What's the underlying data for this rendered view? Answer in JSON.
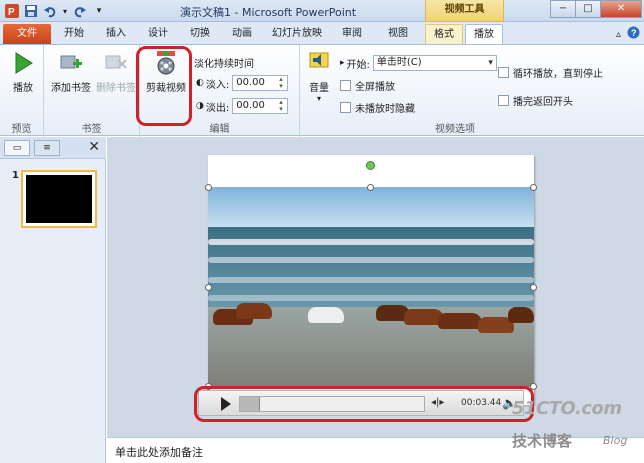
{
  "window": {
    "title": "演示文稿1 - Microsoft PowerPoint",
    "context_tab_group": "视频工具",
    "minimize": "−",
    "maximize": "□",
    "close": "✕"
  },
  "tabs": {
    "file": "文件",
    "items": [
      "开始",
      "插入",
      "设计",
      "切换",
      "动画",
      "幻灯片放映",
      "审阅",
      "视图",
      "格式",
      "播放"
    ],
    "active": "播放"
  },
  "ribbon": {
    "preview": {
      "button": "播放",
      "group": "预览"
    },
    "bookmarks": {
      "add": "添加书签",
      "remove": "删除书签",
      "group": "书签"
    },
    "editing": {
      "trim": "剪裁视频",
      "fade_title": "淡化持续时间",
      "fade_in_label": "淡入:",
      "fade_in_value": "00.00",
      "fade_out_label": "淡出:",
      "fade_out_value": "00.00",
      "group": "编辑"
    },
    "video_options": {
      "volume": "音量",
      "start_label": "开始:",
      "start_value": "单击时(C)",
      "fullscreen": "全屏播放",
      "hide_when_not_playing": "未播放时隐藏",
      "loop": "循环播放，直到停止",
      "rewind": "播完返回开头",
      "group": "视频选项"
    }
  },
  "slides_pane": {
    "slide_number": "1"
  },
  "player": {
    "time": "00:03.44"
  },
  "notes": {
    "placeholder": "单击此处添加备注"
  },
  "watermark": {
    "site": "51CTO.com",
    "blog_cn": "技术博客",
    "blog": "Blog"
  },
  "colors": {
    "file_tab": "#d4541f",
    "highlight": "#d21f28",
    "context_tab": "#f0d375"
  }
}
